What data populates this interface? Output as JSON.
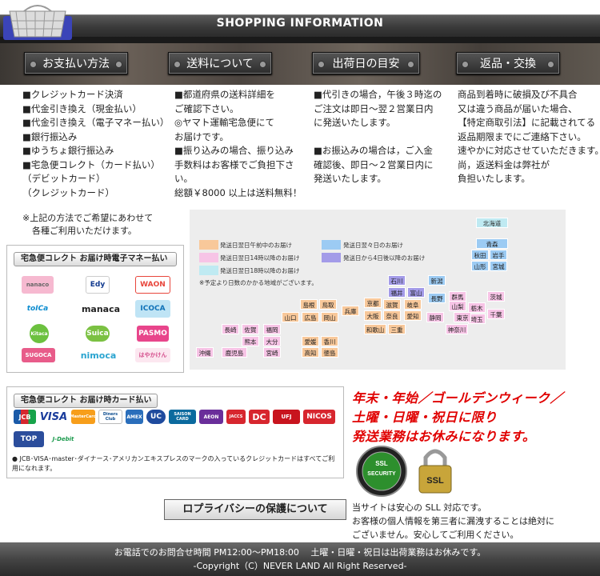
{
  "header": {
    "title": "SHOPPING INFORMATION"
  },
  "tags": {
    "payment": "お支払い方法",
    "shipping": "送料について",
    "ship_date": "出荷日の目安",
    "returns": "返品・交換"
  },
  "columns": {
    "payment": [
      "■クレジットカード決済",
      "■代金引き換え（現金払い）",
      "■代金引き換え（電子マネー払い）",
      "■銀行振込み",
      "■ゆうちょ銀行振込み",
      "■宅急便コレクト（カード払い）",
      "（デビットカード）",
      "（クレジットカード）"
    ],
    "shipping": [
      "■都道府県の送料詳細を",
      "ご確認下さい。",
      "◎ヤマト運輸宅急便にて",
      "お届けです。",
      "■振り込みの場合、振り込み",
      "手数料はお客様でご負担下さ",
      "い。",
      "総額￥8000 以上は送料無料！"
    ],
    "ship_date": [
      "■代引きの場合，午後３時迄の",
      "ご注文は即日～翌２営業日内",
      "に発送いたします。",
      "",
      "■お振込みの場合は，ご入金",
      "確認後、即日～２営業日内に",
      "発送いたします。"
    ],
    "returns": [
      "商品到着時に破損及び不具合",
      "又は違う商品が届いた場合、",
      "【特定商取引法】に記載されてる",
      "返品期限までにご連絡下さい。",
      "速やかに対応させていただきます。",
      "尚，返送料金は弊社が",
      "負担いたします。"
    ]
  },
  "note": [
    "※上記の方法でご希望にあわせて",
    "各種ご利用いただけます。"
  ],
  "emoney_box": {
    "heading": "宅急便コレクト お届け時電子マネー払い",
    "logos": [
      "nanaco",
      "Edy",
      "WAON",
      "toICa",
      "manaca",
      "ICOCA",
      "Kitaca",
      "Suica",
      "PASMO",
      "SUGOCA",
      "nimoca",
      "はやかけん"
    ]
  },
  "card_box": {
    "heading": "宅急便コレクト お届け時カード払い",
    "logos": [
      "JCB",
      "VISA",
      "MasterCard",
      "Diners Club",
      "AMEX",
      "UC",
      "SAISON CARD",
      "AEON",
      "JACCS",
      "DC",
      "UFJ",
      "NICOS",
      "TOP",
      "J-Debit"
    ],
    "notice": "● JCB･VISA･master･ダイナース･アメリカンエキスプレスのマークの入っているクレジットカードはすべてご利用になれます。"
  },
  "map": {
    "legend": [
      "発送日翌日午前中のお届け",
      "発送日翌日14時以降のお届け",
      "発送日翌日18時以降のお届け",
      "発送日翌々日のお届け",
      "発送日から4日後以降のお届け"
    ],
    "legend_colors": [
      "#f8c89a",
      "#f7c4e6",
      "#bfeaf2",
      "#9ccbf3",
      "#a39be8"
    ],
    "note": "※予定より日数のかかる地域がございます。",
    "prefs": [
      "北海道",
      "青森",
      "秋田",
      "岩手",
      "山形",
      "宮城",
      "石川",
      "新潟",
      "福井",
      "富山",
      "長野",
      "群馬",
      "栃木",
      "茨城",
      "島根",
      "鳥取",
      "京都",
      "滋賀",
      "岐阜",
      "山梨",
      "埼玉",
      "山口",
      "広島",
      "岡山",
      "兵庫",
      "大阪",
      "奈良",
      "愛知",
      "静岡",
      "東京",
      "千葉",
      "長崎",
      "佐賀",
      "福岡",
      "和歌山",
      "三重",
      "神奈川",
      "熊本",
      "大分",
      "愛媛",
      "香川",
      "沖縄",
      "鹿児島",
      "宮崎",
      "高知",
      "徳島"
    ]
  },
  "warning": [
    "年末・年始／ゴールデンウィーク／",
    "土曜・日曜・祝日に限り",
    "発送業務はお休みになります。"
  ],
  "badges": {
    "security": "SECURITY",
    "ssl": "SSL"
  },
  "privacy": {
    "title": "ロプライバシーの保護について",
    "text": [
      "当サイトは安心の SLL 対応です。",
      "お客様の個人情報を第三者に漏洩することは絶対に",
      "ございません。安心してご利用ください。"
    ]
  },
  "footer": {
    "line1": "お電話でのお問合せ時間 PM12:00～PM18:00　 土曜・日曜・祝日は出荷業務はお休みです。",
    "line2": "-Copyright（C）NEVER LAND All Right Reserved-"
  }
}
